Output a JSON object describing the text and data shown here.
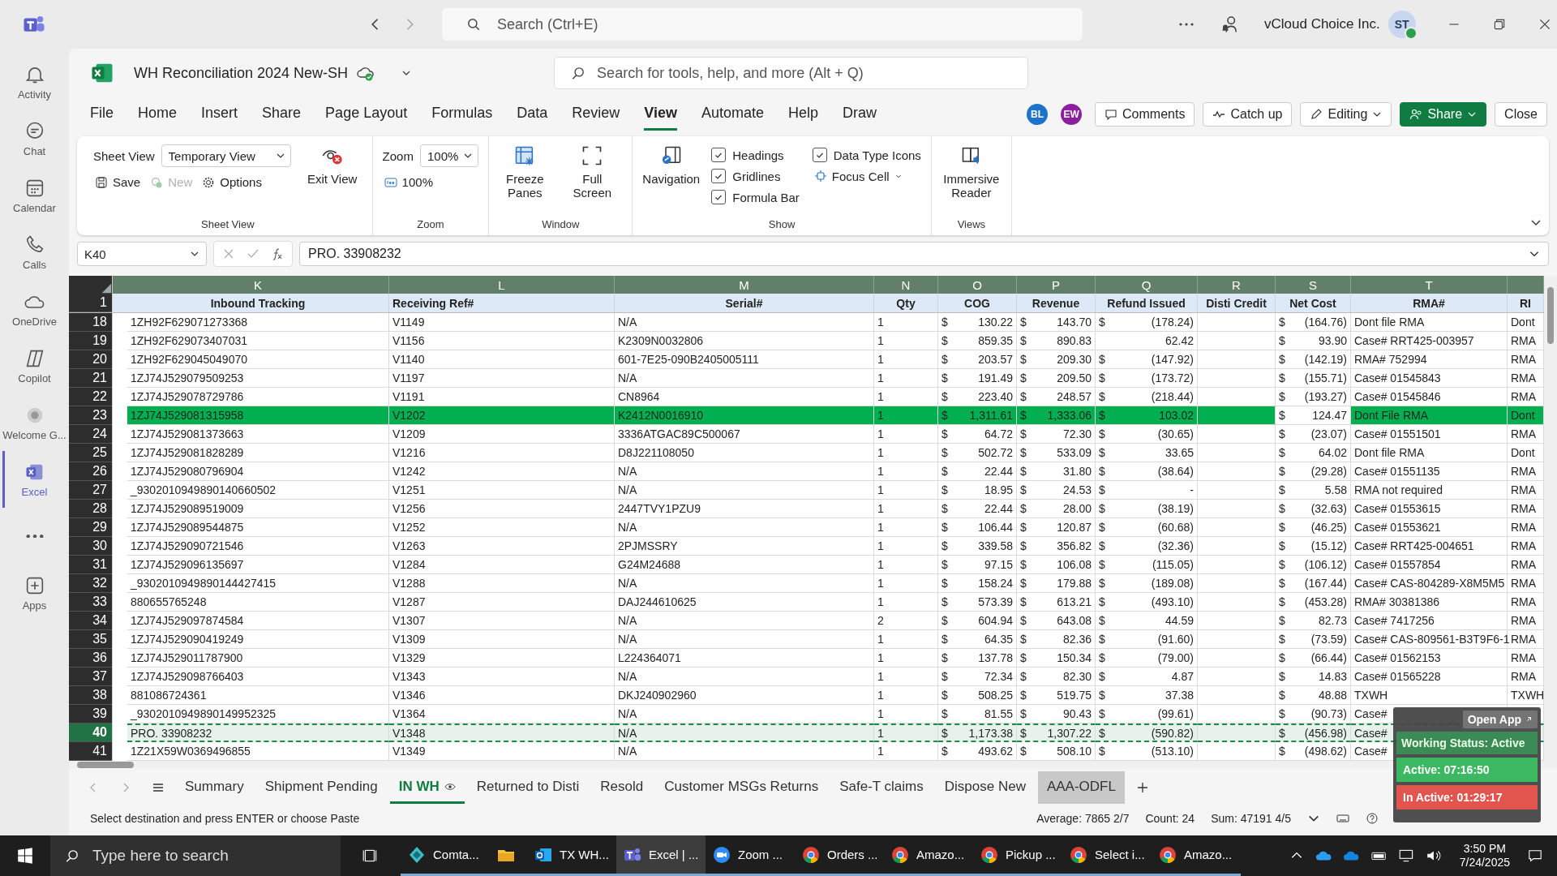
{
  "teams": {
    "search": "Search (Ctrl+E)",
    "org": "vCloud Choice Inc.",
    "avatar": "ST"
  },
  "rail": [
    {
      "label": "Activity",
      "kind": "bell",
      "selected": false
    },
    {
      "label": "Chat",
      "kind": "chat",
      "selected": false
    },
    {
      "label": "Calendar",
      "kind": "calendar",
      "selected": false
    },
    {
      "label": "Calls",
      "kind": "phone",
      "selected": false
    },
    {
      "label": "OneDrive",
      "kind": "cloud",
      "selected": false
    },
    {
      "label": "Copilot",
      "kind": "copilot",
      "selected": false
    },
    {
      "label": "Welcome G...",
      "kind": "globe",
      "selected": false
    },
    {
      "label": "Excel",
      "kind": "excel",
      "selected": true
    },
    {
      "kind": "more",
      "selected": false
    },
    {
      "label": "Apps",
      "kind": "apps",
      "selected": false
    }
  ],
  "workbook": {
    "title": "WH Reconciliation 2024 New-SH",
    "search": "Search for tools, help, and more (Alt + Q)"
  },
  "menu": [
    {
      "label": "File",
      "selected": false
    },
    {
      "label": "Home",
      "selected": false
    },
    {
      "label": "Insert",
      "selected": false
    },
    {
      "label": "Share",
      "selected": false
    },
    {
      "label": "Page Layout",
      "selected": false
    },
    {
      "label": "Formulas",
      "selected": false
    },
    {
      "label": "Data",
      "selected": false
    },
    {
      "label": "Review",
      "selected": false
    },
    {
      "label": "View",
      "selected": true
    },
    {
      "label": "Automate",
      "selected": false
    },
    {
      "label": "Help",
      "selected": false
    },
    {
      "label": "Draw",
      "selected": false
    }
  ],
  "collaborators": [
    {
      "initials": "BL",
      "color": "#1b74c9"
    },
    {
      "initials": "EW",
      "color": "#8b1f9e"
    }
  ],
  "actions": [
    {
      "label": "Comments",
      "kind": "comments"
    },
    {
      "label": "Catch up",
      "kind": "catchup"
    },
    {
      "label": "Editing",
      "kind": "editing"
    },
    {
      "label": "Share",
      "kind": "share"
    },
    {
      "label": "Close",
      "kind": "close"
    }
  ],
  "ribbon": {
    "sheet_view": {
      "label": "Sheet View",
      "view": "Temporary View",
      "save": "Save",
      "new": {
        "label": "New",
        "disabled": true
      },
      "options": "Options",
      "exit": "Exit View",
      "group": "Sheet View"
    },
    "zoom": {
      "label": "Zoom",
      "value": "100%",
      "reset": "100%",
      "group": "Zoom"
    },
    "window": {
      "freeze": "Freeze Panes",
      "full": "Full Screen",
      "group": "Window"
    },
    "show": {
      "navigation": "Navigation",
      "checks": [
        {
          "label": "Headings",
          "checked": true
        },
        {
          "label": "Gridlines",
          "checked": true
        },
        {
          "label": "Formula Bar",
          "checked": true
        },
        {
          "label": "Data Type Icons",
          "checked": true
        }
      ],
      "focus": "Focus Cell",
      "group": "Show"
    },
    "views": {
      "reader": "Immersive Reader",
      "group": "Views"
    }
  },
  "formula_bar": {
    "cell": "K40",
    "formula": "PRO. 33908232"
  },
  "columns": [
    {
      "letter": "K",
      "heading": "Inbound Tracking"
    },
    {
      "letter": "L",
      "heading": "Receiving Ref#"
    },
    {
      "letter": "M",
      "heading": "Serial#"
    },
    {
      "letter": "N",
      "heading": "Qty"
    },
    {
      "letter": "O",
      "heading": "COG"
    },
    {
      "letter": "P",
      "heading": "Revenue"
    },
    {
      "letter": "Q",
      "heading": "Refund Issued"
    },
    {
      "letter": "R",
      "heading": "Disti Credit"
    },
    {
      "letter": "S",
      "heading": "Net Cost"
    },
    {
      "letter": "T",
      "heading": "RMA#"
    },
    {
      "heading": "RI"
    }
  ],
  "header_row": "1",
  "rows": [
    {
      "num": "18",
      "k": "1ZH92F629071273368",
      "l": "V1149",
      "m": "N/A",
      "qty": "1",
      "cog": [
        "$",
        "130.22"
      ],
      "rev": [
        "$",
        "143.70"
      ],
      "refund": [
        "$",
        "(178.24)"
      ],
      "net": [
        "$",
        "(164.76)"
      ],
      "rma": "Dont file RMA",
      "u": "Dont",
      "highlighted": false,
      "selected": false
    },
    {
      "num": "19",
      "k": "1ZH92F629073407031",
      "l": "V1156",
      "m": "K2309N0032806",
      "qty": "1",
      "cog": [
        "$",
        "859.35"
      ],
      "rev": [
        "$",
        "890.83"
      ],
      "refund": [
        "62.42"
      ],
      "net": [
        "$",
        "93.90"
      ],
      "rma": "Case# RRT425-003957",
      "u": "RMA",
      "highlighted": false,
      "selected": false
    },
    {
      "num": "20",
      "k": "1ZH92F629045049070",
      "l": "V1140",
      "m": "601-7E25-090B2405005111",
      "qty": "1",
      "cog": [
        "$",
        "203.57"
      ],
      "rev": [
        "$",
        "209.30"
      ],
      "refund": [
        "$",
        "(147.92)"
      ],
      "net": [
        "$",
        "(142.19)"
      ],
      "rma": "RMA# 752994",
      "u": "RMA",
      "highlighted": false,
      "selected": false
    },
    {
      "num": "21",
      "k": "1ZJ74J529079509253",
      "l": "V1197",
      "m": "N/A",
      "qty": "1",
      "cog": [
        "$",
        "191.49"
      ],
      "rev": [
        "$",
        "209.50"
      ],
      "refund": [
        "$",
        "(173.72)"
      ],
      "net": [
        "$",
        "(155.71)"
      ],
      "rma": "Case# 01545843",
      "u": "RMA",
      "highlighted": false,
      "selected": false
    },
    {
      "num": "22",
      "k": "1ZJ74J529078729786",
      "l": "V1191",
      "m": "CN8964",
      "qty": "1",
      "cog": [
        "$",
        "223.40"
      ],
      "rev": [
        "$",
        "248.57"
      ],
      "refund": [
        "$",
        "(218.44)"
      ],
      "net": [
        "$",
        "(193.27)"
      ],
      "rma": "Case# 01545846",
      "u": "RMA",
      "highlighted": false,
      "selected": false
    },
    {
      "num": "23",
      "k": "1ZJ74J529081315958",
      "l": "V1202",
      "m": "K2412N0016910",
      "qty": "1",
      "cog": [
        "$",
        "1,311.61"
      ],
      "rev": [
        "$",
        "1,333.06"
      ],
      "refund": [
        "$",
        "103.02"
      ],
      "net": [
        "$",
        "124.47"
      ],
      "rma": "Dont File RMA",
      "u": "Dont",
      "highlighted": true,
      "selected": false
    },
    {
      "num": "24",
      "k": "1ZJ74J529081373663",
      "l": "V1209",
      "m": "3336ATGAC89C500067",
      "qty": "1",
      "cog": [
        "$",
        "64.72"
      ],
      "rev": [
        "$",
        "72.30"
      ],
      "refund": [
        "$",
        "(30.65)"
      ],
      "net": [
        "$",
        "(23.07)"
      ],
      "rma": "Case# 01551501",
      "u": "RMA",
      "highlighted": false,
      "selected": false
    },
    {
      "num": "25",
      "k": "1ZJ74J529081828289",
      "l": "V1216",
      "m": "D8J221108050",
      "qty": "1",
      "cog": [
        "$",
        "502.72"
      ],
      "rev": [
        "$",
        "533.09"
      ],
      "refund": [
        "$",
        "33.65"
      ],
      "net": [
        "$",
        "64.02"
      ],
      "rma": "Dont file RMA",
      "u": "Dont",
      "highlighted": false,
      "selected": false
    },
    {
      "num": "26",
      "k": "1ZJ74J529080796904",
      "l": "V1242",
      "m": "N/A",
      "qty": "1",
      "cog": [
        "$",
        "22.44"
      ],
      "rev": [
        "$",
        "31.80"
      ],
      "refund": [
        "$",
        "(38.64)"
      ],
      "net": [
        "$",
        "(29.28)"
      ],
      "rma": "Case# 01551135",
      "u": "RMA",
      "highlighted": false,
      "selected": false
    },
    {
      "num": "27",
      "k": "_9302010949890140660502",
      "l": "V1251",
      "m": "N/A",
      "qty": "1",
      "cog": [
        "$",
        "18.95"
      ],
      "rev": [
        "$",
        "24.53"
      ],
      "refund": [
        "$",
        "-"
      ],
      "net": [
        "$",
        "5.58"
      ],
      "rma": "RMA not required",
      "u": "RMA",
      "highlighted": false,
      "selected": false
    },
    {
      "num": "28",
      "k": "1ZJ74J529089519009",
      "l": "V1256",
      "m": "2447TVY1PZU9",
      "qty": "1",
      "cog": [
        "$",
        "22.44"
      ],
      "rev": [
        "$",
        "28.00"
      ],
      "refund": [
        "$",
        "(38.19)"
      ],
      "net": [
        "$",
        "(32.63)"
      ],
      "rma": "Case# 01553615",
      "u": "RMA",
      "highlighted": false,
      "selected": false
    },
    {
      "num": "29",
      "k": "1ZJ74J529089544875",
      "l": "V1252",
      "m": "N/A",
      "qty": "1",
      "cog": [
        "$",
        "106.44"
      ],
      "rev": [
        "$",
        "120.87"
      ],
      "refund": [
        "$",
        "(60.68)"
      ],
      "net": [
        "$",
        "(46.25)"
      ],
      "rma": "Case# 01553621",
      "u": "RMA",
      "highlighted": false,
      "selected": false
    },
    {
      "num": "30",
      "k": "1ZJ74J529090721546",
      "l": "V1263",
      "m": "2PJMSSRY",
      "qty": "1",
      "cog": [
        "$",
        "339.58"
      ],
      "rev": [
        "$",
        "356.82"
      ],
      "refund": [
        "$",
        "(32.36)"
      ],
      "net": [
        "$",
        "(15.12)"
      ],
      "rma": "Case# RRT425-004651",
      "u": "RMA",
      "highlighted": false,
      "selected": false
    },
    {
      "num": "31",
      "k": "1ZJ74J529096135697",
      "l": "V1284",
      "m": "G24M24688",
      "qty": "1",
      "cog": [
        "$",
        "97.15"
      ],
      "rev": [
        "$",
        "106.08"
      ],
      "refund": [
        "$",
        "(115.05)"
      ],
      "net": [
        "$",
        "(106.12)"
      ],
      "rma": "Case# 01557854",
      "u": "RMA",
      "highlighted": false,
      "selected": false
    },
    {
      "num": "32",
      "k": "_9302010949890144427415",
      "l": "V1288",
      "m": "N/A",
      "qty": "1",
      "cog": [
        "$",
        "158.24"
      ],
      "rev": [
        "$",
        "179.88"
      ],
      "refund": [
        "$",
        "(189.08)"
      ],
      "net": [
        "$",
        "(167.44)"
      ],
      "rma": "Case# CAS-804289-X8M5M5",
      "u": "RMA",
      "highlighted": false,
      "selected": false
    },
    {
      "num": "33",
      "k": "880655765248",
      "l": "V1287",
      "m": "DAJ244610625",
      "qty": "1",
      "cog": [
        "$",
        "573.39"
      ],
      "rev": [
        "$",
        "613.21"
      ],
      "refund": [
        "$",
        "(493.10)"
      ],
      "net": [
        "$",
        "(453.28)"
      ],
      "rma": "RMA# 30381386",
      "u": "RMA",
      "highlighted": false,
      "selected": false
    },
    {
      "num": "34",
      "k": "1ZJ74J529097874584",
      "l": "V1307",
      "m": "N/A",
      "qty": "2",
      "cog": [
        "$",
        "604.94"
      ],
      "rev": [
        "$",
        "643.08"
      ],
      "refund": [
        "$",
        "44.59"
      ],
      "net": [
        "$",
        "82.73"
      ],
      "rma": "Case# 7417256",
      "u": "RMA",
      "highlighted": false,
      "selected": false
    },
    {
      "num": "35",
      "k": "1ZJ74J529090419249",
      "l": "V1309",
      "m": "N/A",
      "qty": "1",
      "cog": [
        "$",
        "64.35"
      ],
      "rev": [
        "$",
        "82.36"
      ],
      "refund": [
        "$",
        "(91.60)"
      ],
      "net": [
        "$",
        "(73.59)"
      ],
      "rma": "Case# CAS-809561-B3T9F6-1",
      "u": "RMA",
      "highlighted": false,
      "selected": false
    },
    {
      "num": "36",
      "k": "1ZJ74J529011787900",
      "l": "V1329",
      "m": "L224364071",
      "qty": "1",
      "cog": [
        "$",
        "137.78"
      ],
      "rev": [
        "$",
        "150.34"
      ],
      "refund": [
        "$",
        "(79.00)"
      ],
      "net": [
        "$",
        "(66.44)"
      ],
      "rma": "Case# 01562153",
      "u": "RMA",
      "highlighted": false,
      "selected": false
    },
    {
      "num": "37",
      "k": "1ZJ74J529098766403",
      "l": "V1343",
      "m": "N/A",
      "qty": "1",
      "cog": [
        "$",
        "72.34"
      ],
      "rev": [
        "$",
        "82.30"
      ],
      "refund": [
        "$",
        "4.87"
      ],
      "net": [
        "$",
        "14.83"
      ],
      "rma": "Case# 01565228",
      "u": "RMA",
      "highlighted": false,
      "selected": false
    },
    {
      "num": "38",
      "k": "881086724361",
      "l": "V1346",
      "m": "DKJ240902960",
      "qty": "1",
      "cog": [
        "$",
        "508.25"
      ],
      "rev": [
        "$",
        "519.75"
      ],
      "refund": [
        "$",
        "37.38"
      ],
      "net": [
        "$",
        "48.88"
      ],
      "rma": "TXWH",
      "u": "TXWH",
      "highlighted": false,
      "selected": false
    },
    {
      "num": "39",
      "k": "_9302010949890149952325",
      "l": "V1364",
      "m": "N/A",
      "qty": "1",
      "cog": [
        "$",
        "81.55"
      ],
      "rev": [
        "$",
        "90.43"
      ],
      "refund": [
        "$",
        "(99.61)"
      ],
      "net": [
        "$",
        "(90.73)"
      ],
      "rma": "Case#",
      "highlighted": false,
      "selected": false
    },
    {
      "num": "40",
      "k": "PRO. 33908232",
      "l": "V1348",
      "m": "N/A",
      "qty": "1",
      "cog": [
        "$",
        "1,173.38"
      ],
      "rev": [
        "$",
        "1,307.22"
      ],
      "refund": [
        "$",
        "(590.82)"
      ],
      "net": [
        "$",
        "(456.98)"
      ],
      "rma": "Case#",
      "highlighted": false,
      "selected": true
    },
    {
      "num": "41",
      "k": "1Z21X59W0369496855",
      "l": "V1349",
      "m": "N/A",
      "qty": "1",
      "cog": [
        "$",
        "493.62"
      ],
      "rev": [
        "$",
        "508.10"
      ],
      "refund": [
        "$",
        "(513.10)"
      ],
      "net": [
        "$",
        "(498.62)"
      ],
      "rma": "Case#",
      "highlighted": false,
      "selected": false
    }
  ],
  "sheets": [
    {
      "label": "Summary",
      "selected": false,
      "highlighted": false
    },
    {
      "label": "Shipment Pending",
      "selected": false,
      "highlighted": false
    },
    {
      "label": "IN WH",
      "selected": true,
      "highlighted": false
    },
    {
      "label": "Returned to Disti",
      "selected": false,
      "highlighted": false
    },
    {
      "label": "Resold",
      "selected": false,
      "highlighted": false
    },
    {
      "label": "Customer MSGs Returns",
      "selected": false,
      "highlighted": false
    },
    {
      "label": "Safe-T claims",
      "selected": false,
      "highlighted": false
    },
    {
      "label": "Dispose New",
      "selected": false,
      "highlighted": false
    },
    {
      "label": "AAA-ODFL",
      "selected": false,
      "highlighted": true
    }
  ],
  "status_bar": {
    "message": "Select destination and press ENTER or choose Paste",
    "average": "Average: 7865 2/7",
    "count": "Count: 24",
    "sum": "Sum: 47191 4/5"
  },
  "widget": {
    "open": "Open App",
    "status": "Working Status: Active",
    "active": "Active: 07:16:50",
    "inactive": "In Active: 01:29:17"
  },
  "taskbar": {
    "search": "Type here to search",
    "apps": [
      {
        "label": "Comta...",
        "kind": "diamond",
        "selected": false
      },
      {
        "kind": "folder",
        "selected": false
      },
      {
        "label": "TX WH...",
        "kind": "outlook",
        "selected": false
      },
      {
        "label": "Excel | ...",
        "kind": "teams",
        "selected": true
      },
      {
        "label": "Zoom ...",
        "kind": "zoom",
        "selected": false
      },
      {
        "label": "Orders ...",
        "kind": "chrome",
        "selected": false
      },
      {
        "label": "Amazo...",
        "kind": "chrome",
        "selected": false
      },
      {
        "label": "Pickup ...",
        "kind": "chrome",
        "selected": false
      },
      {
        "label": "Select i...",
        "kind": "chrome",
        "selected": false
      },
      {
        "label": "Amazo...",
        "kind": "chrome",
        "selected": false
      }
    ],
    "time": "3:50 PM",
    "date": "7/24/2025"
  }
}
